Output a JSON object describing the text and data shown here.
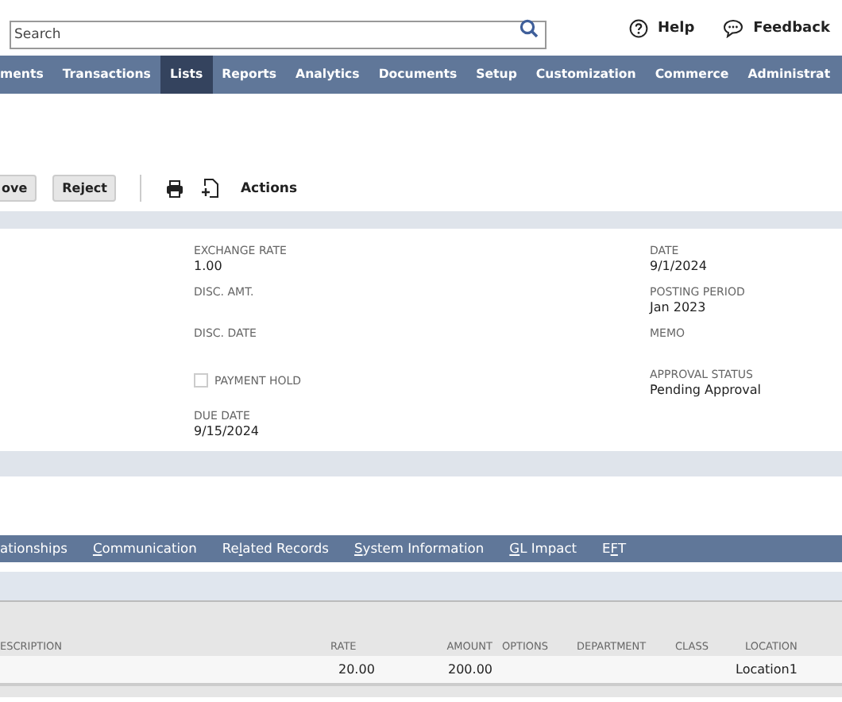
{
  "search": {
    "placeholder": "Search"
  },
  "header_links": [
    {
      "label": "Help"
    },
    {
      "label": "Feedback"
    }
  ],
  "nav": [
    {
      "label": "ments",
      "selected": false
    },
    {
      "label": "Transactions",
      "selected": false
    },
    {
      "label": "Lists",
      "selected": true
    },
    {
      "label": "Reports",
      "selected": false
    },
    {
      "label": "Analytics",
      "selected": false
    },
    {
      "label": "Documents",
      "selected": false
    },
    {
      "label": "Setup",
      "selected": false
    },
    {
      "label": "Customization",
      "selected": false
    },
    {
      "label": "Commerce",
      "selected": false
    },
    {
      "label": "Administrat",
      "selected": false
    }
  ],
  "toolbar": {
    "buttons": [
      "ove",
      "Reject"
    ],
    "actions": "Actions"
  },
  "fields": [
    [
      {
        "kind": "field",
        "label": "EXCHANGE RATE",
        "value": "1.00"
      },
      {
        "kind": "field",
        "label": "DISC. AMT."
      },
      {
        "kind": "field",
        "label": "DISC. DATE"
      },
      {
        "kind": "checkbox",
        "label": "PAYMENT HOLD",
        "checked": false
      },
      {
        "kind": "field",
        "label": "DUE DATE",
        "value": "9/15/2024"
      }
    ],
    [
      {
        "kind": "field",
        "label": "DATE",
        "value": "9/1/2024"
      },
      {
        "kind": "field",
        "label": "POSTING PERIOD",
        "value": "Jan 2023"
      },
      {
        "kind": "field",
        "label": "MEMO"
      },
      {
        "kind": "field",
        "label": "APPROVAL STATUS",
        "value": "Pending Approval"
      }
    ]
  ],
  "subtabs": [
    {
      "before": "ationships"
    },
    {
      "key": "C",
      "after": "ommunication"
    },
    {
      "before": "Re",
      "key": "l",
      "after": "ated Records"
    },
    {
      "key": "S",
      "after": "ystem Information"
    },
    {
      "key": "G",
      "after": "L Impact"
    },
    {
      "before": "E",
      "key": "F",
      "after": "T"
    }
  ],
  "table": {
    "columns": [
      "ESCRIPTION",
      "RATE",
      "AMOUNT",
      "OPTIONS",
      "DEPARTMENT",
      "CLASS",
      "LOCATION"
    ],
    "rows": [
      [
        "",
        "20.00",
        "200.00",
        "",
        "",
        "",
        "Location1"
      ]
    ]
  }
}
